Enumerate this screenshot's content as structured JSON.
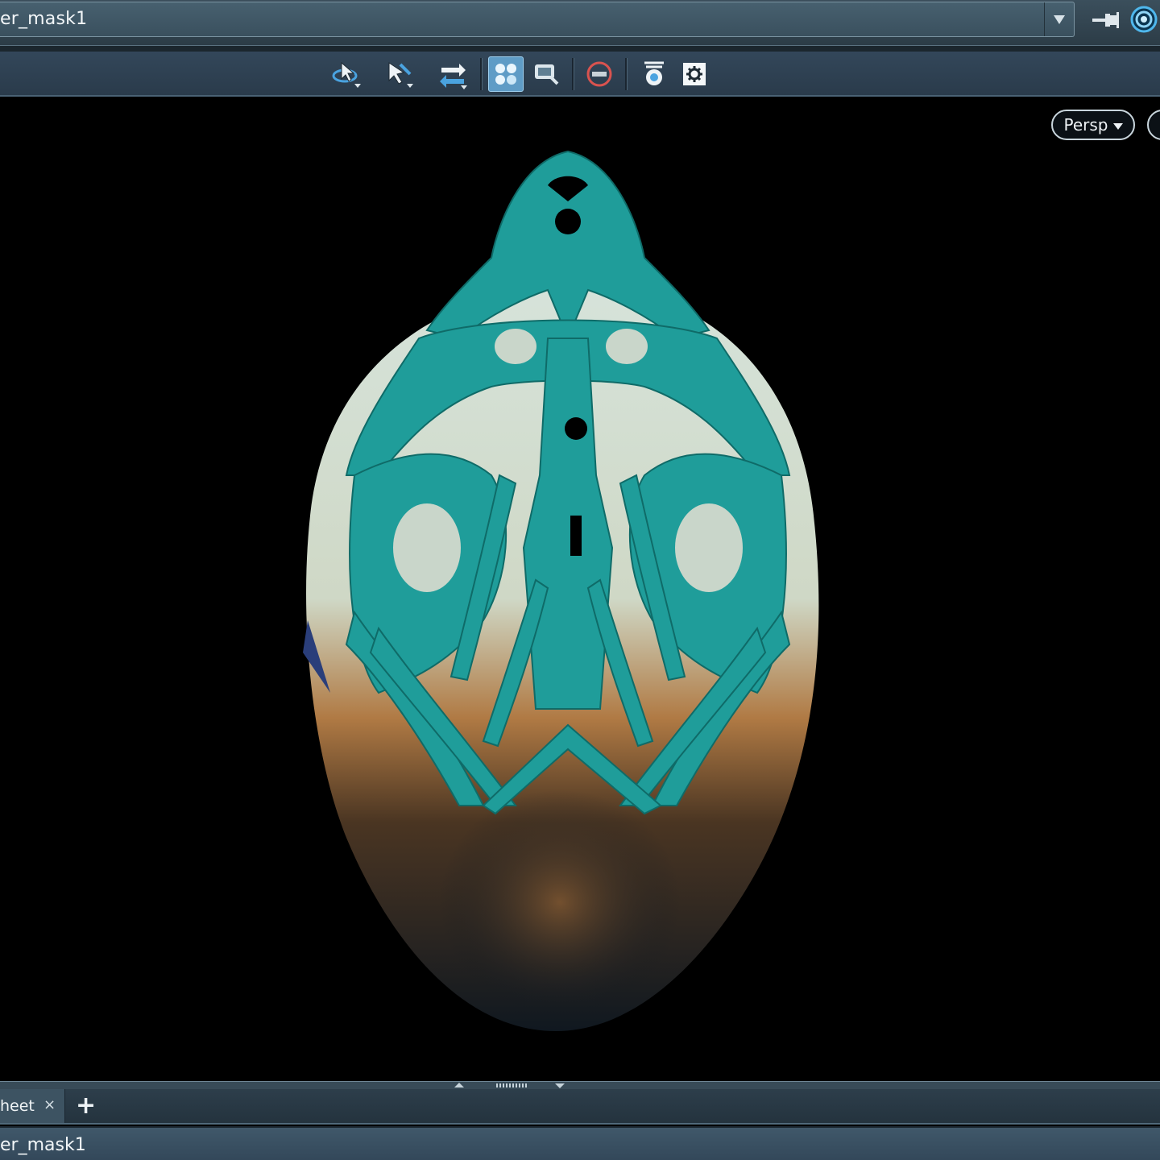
{
  "top_path": {
    "text": "er_mask1",
    "dropdown_icon": "chevron-down-icon",
    "pin_icon": "pin-icon",
    "target_icon": "target-icon"
  },
  "toolbar": {
    "tools": [
      {
        "icon": "orbit-select-icon"
      },
      {
        "icon": "select-arrow-icon"
      },
      {
        "icon": "transform-icon"
      },
      {
        "icon": "snapshot-icon",
        "active": true
      },
      {
        "icon": "zoom-view-icon"
      },
      {
        "icon": "disable-icon"
      },
      {
        "icon": "light-icon"
      },
      {
        "icon": "settings-icon"
      }
    ]
  },
  "viewport": {
    "camera_label": "Persp",
    "colors": {
      "mask": "#1f9d9a",
      "head_light": "#c8d6cc",
      "head_warm": "#a8703a",
      "background": "#000000"
    }
  },
  "tabs": {
    "items": [
      {
        "label": "heet",
        "close": "×"
      }
    ],
    "add_label": "+"
  },
  "bottom_path": {
    "text": "er_mask1"
  }
}
